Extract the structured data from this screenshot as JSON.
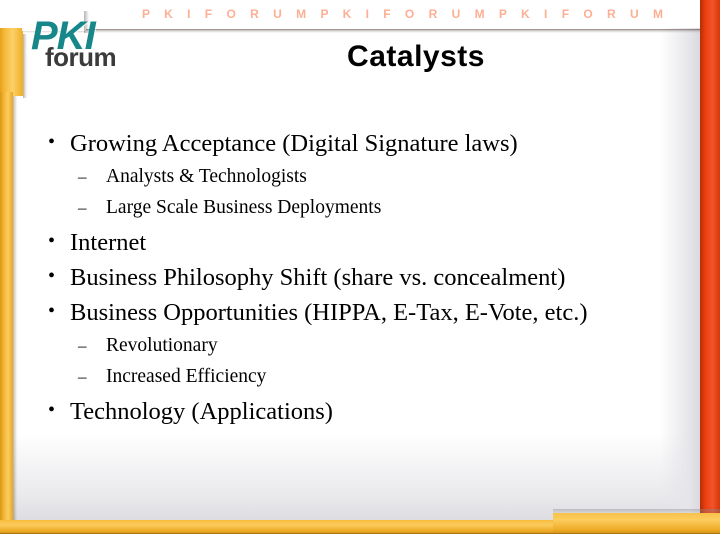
{
  "slide": {
    "title": "Catalysts",
    "banner_text": "P K I   F O R U M   P K I   F O R U M   P K I   F O R U M",
    "logo": {
      "primary": "PKI",
      "secondary": "forum"
    },
    "colors": {
      "banner_orange": "#ec3f0d",
      "right_bar_red": "#ea3f0e",
      "frame_amber": "#f6bb3c",
      "logo_teal": "#17878a",
      "logo_gray": "#3b3b3b",
      "text_black": "#000000",
      "background_white": "#ffffff"
    },
    "bullet_marks": {
      "level1": "•",
      "level2": "–"
    },
    "content": [
      {
        "level": 1,
        "text": "Growing Acceptance (Digital Signature laws)"
      },
      {
        "level": 2,
        "text": "Analysts & Technologists"
      },
      {
        "level": 2,
        "text": "Large Scale Business Deployments"
      },
      {
        "level": 1,
        "text": "Internet"
      },
      {
        "level": 1,
        "text": "Business Philosophy Shift (share vs. concealment)"
      },
      {
        "level": 1,
        "text": "Business Opportunities (HIPPA, E-Tax, E-Vote, etc.)"
      },
      {
        "level": 2,
        "text": "Revolutionary"
      },
      {
        "level": 2,
        "text": "Increased Efficiency"
      },
      {
        "level": 1,
        "text": "Technology (Applications)"
      }
    ]
  }
}
